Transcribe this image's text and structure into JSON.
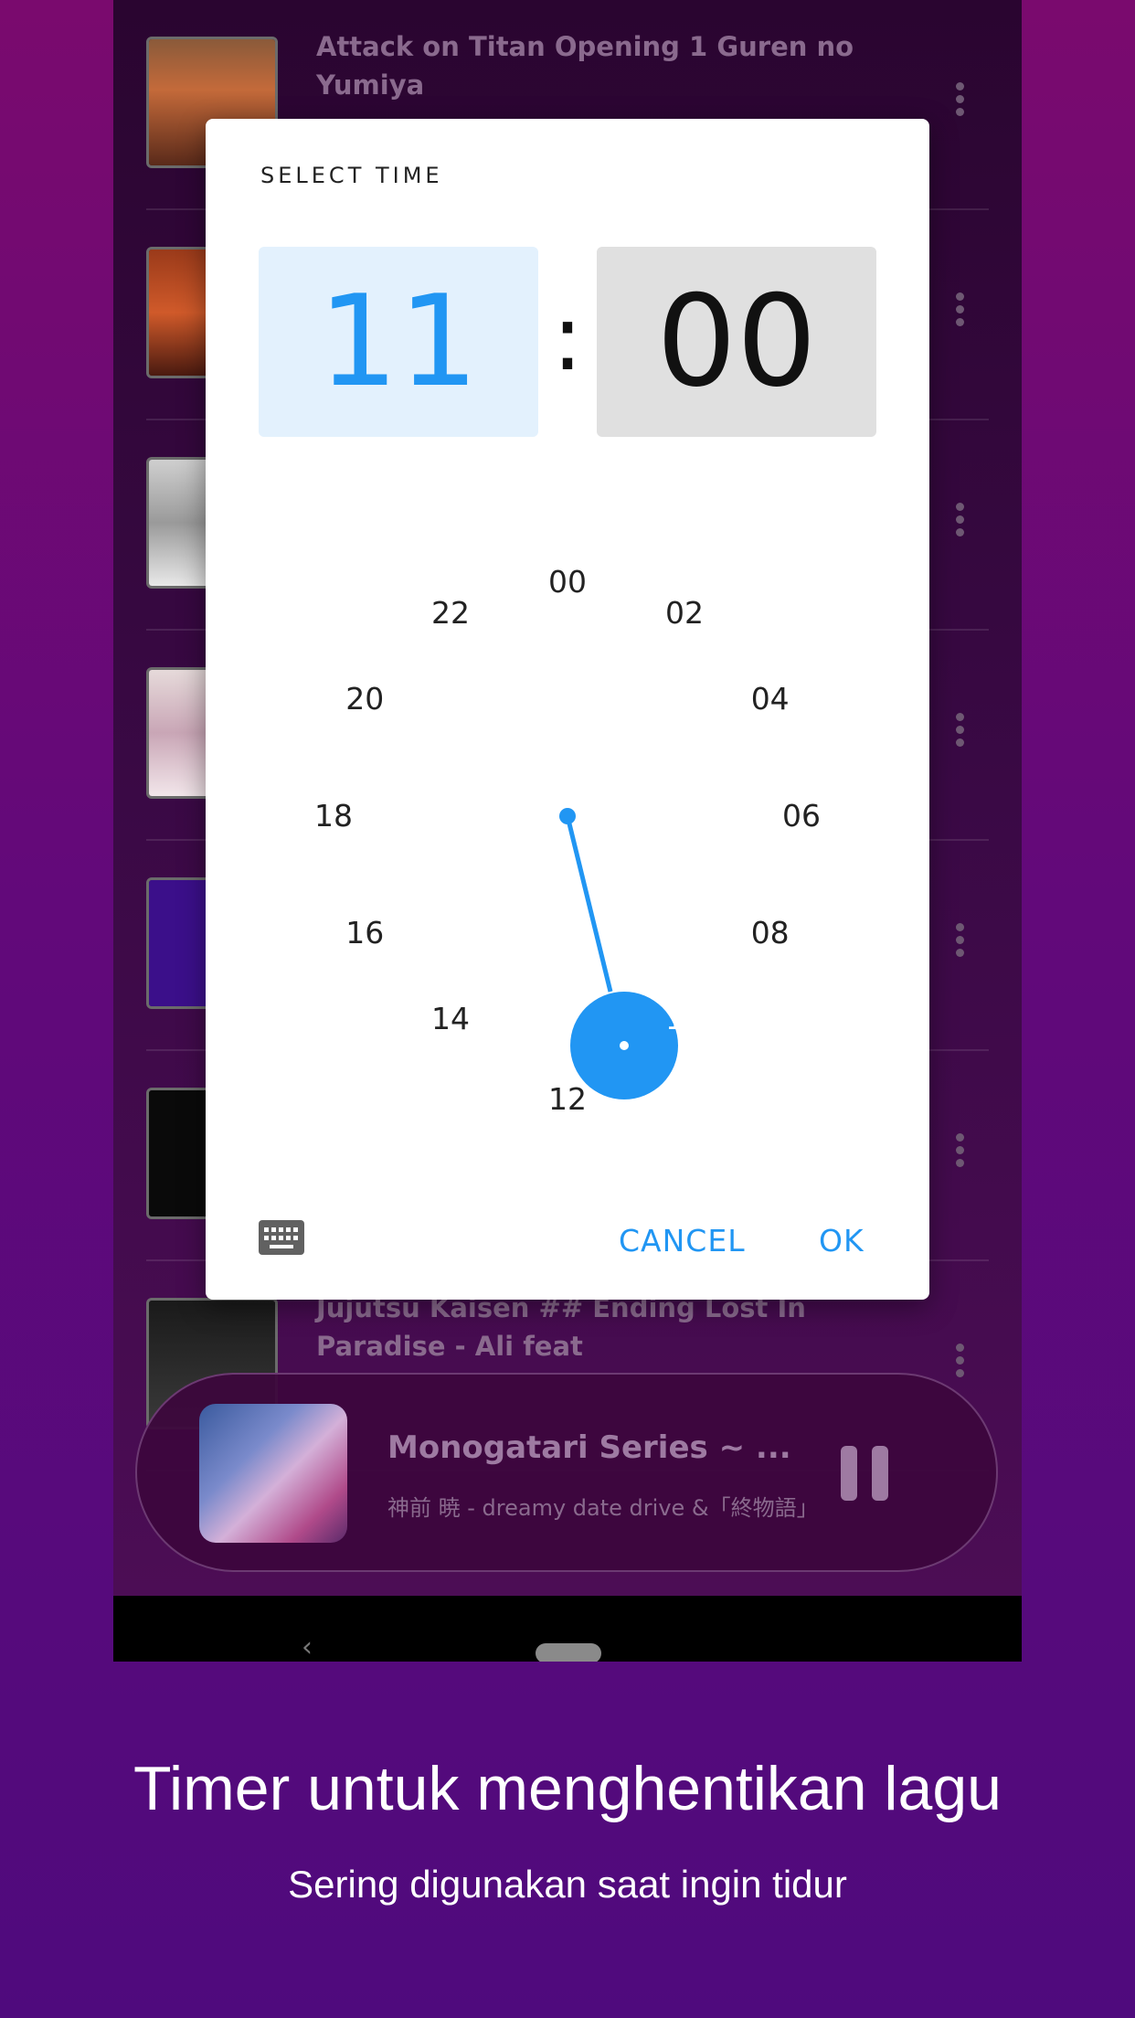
{
  "song_list": {
    "items": [
      {
        "title": "Attack on Titan Opening 1 Guren no Yumiya"
      },
      {
        "title": ""
      },
      {
        "title": ""
      },
      {
        "title": ""
      },
      {
        "title": ""
      },
      {
        "title": ""
      },
      {
        "title": "Jujutsu Kaisen ## Ending Lost In Paradise - Ali feat"
      }
    ]
  },
  "now_playing": {
    "title": "Monogatari Series ~ ...",
    "subtitle": "神前 暁 - dreamy date drive &「終物語」"
  },
  "time_picker": {
    "header": "SELECT TIME",
    "hour": "11",
    "separator": ":",
    "minute": "00",
    "dial_labels": [
      "00",
      "02",
      "04",
      "06",
      "08",
      "10",
      "12",
      "14",
      "16",
      "18",
      "20",
      "22"
    ],
    "selected_value": "11",
    "cancel_label": "CANCEL",
    "ok_label": "OK",
    "accent_color": "#2196f3"
  },
  "caption": {
    "title": "Timer untuk menghentikan lagu",
    "subtitle": "Sering digunakan saat ingin tidur"
  }
}
